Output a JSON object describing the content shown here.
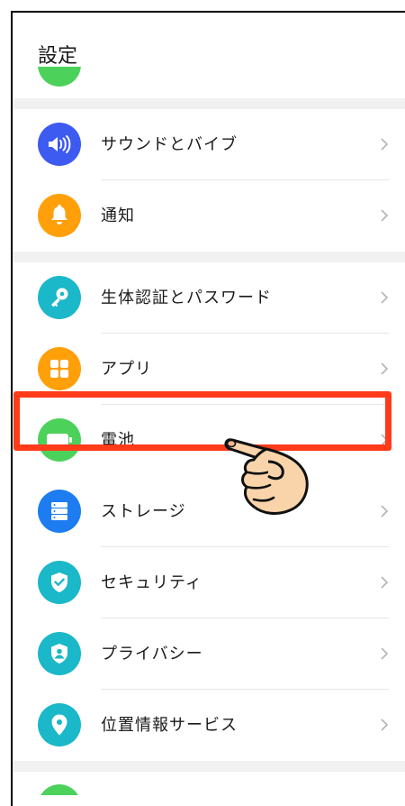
{
  "header": {
    "title": "設定"
  },
  "colors": {
    "green": "#4cd15b",
    "blue_sound": "#3d5af1",
    "orange": "#ff9f0a",
    "teal": "#1ab8c8",
    "blue_storage": "#1c7cf0",
    "highlight": "#ff3b1a"
  },
  "settings": {
    "items": [
      {
        "label": "サウンドとバイブ",
        "icon": "speaker-icon"
      },
      {
        "label": "通知",
        "icon": "bell-icon"
      },
      {
        "label": "生体認証とパスワード",
        "icon": "key-icon"
      },
      {
        "label": "アプリ",
        "icon": "apps-grid-icon"
      },
      {
        "label": "電池",
        "icon": "battery-icon"
      },
      {
        "label": "ストレージ",
        "icon": "storage-icon"
      },
      {
        "label": "セキュリティ",
        "icon": "shield-check-icon"
      },
      {
        "label": "プライバシー",
        "icon": "privacy-shield-icon"
      },
      {
        "label": "位置情報サービス",
        "icon": "location-pin-icon"
      }
    ]
  }
}
